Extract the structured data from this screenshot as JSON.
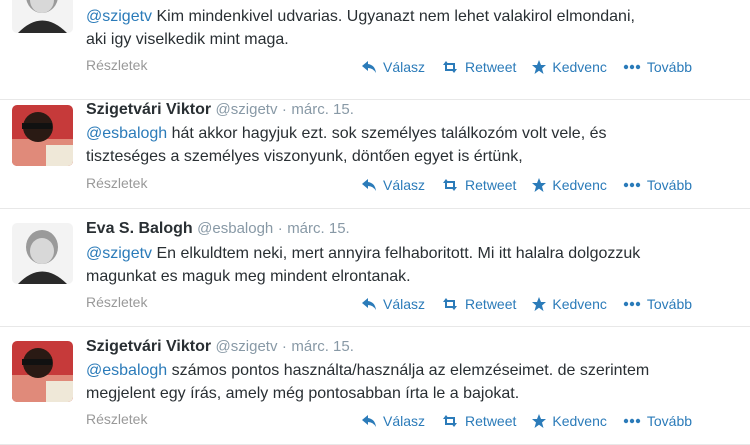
{
  "detailsLabel": "Részletek",
  "actions": {
    "reply": "Válasz",
    "retweet": "Retweet",
    "favorite": "Kedvenc",
    "more": "Tovább"
  },
  "colors": {
    "link": "#2b7bb9",
    "meta": "#8899a6"
  },
  "tweets": [
    {
      "name": "",
      "handle": "",
      "dot": "",
      "time": "",
      "mention": "@szigetv",
      "line1": " Kim mindenkivel udvarias. Ugyanazt nem lehet valakirol elmondani,",
      "line2": "aki igy viselkedik mint maga."
    },
    {
      "name": "Szigetvári Viktor",
      "handle": "@szigetv",
      "dot": "·",
      "time": "márc. 15.",
      "mention": "@esbalogh",
      "line1": " hát akkor hagyjuk ezt. sok személyes találkozóm volt vele, és",
      "line2": "tiszteséges a személyes viszonyunk, döntően egyet is értünk,"
    },
    {
      "name": "Eva S. Balogh",
      "handle": "@esbalogh",
      "dot": "·",
      "time": "márc. 15.",
      "mention": "@szigetv",
      "line1": " En elkuldtem neki, mert annyira felhaboritott. Mi itt halalra dolgozzuk",
      "line2": "magunkat es maguk meg mindent elrontanak."
    },
    {
      "name": "Szigetvári Viktor",
      "handle": "@szigetv",
      "dot": "·",
      "time": "márc. 15.",
      "mention": "@esbalogh",
      "line1": " számos pontos használta/használja az elemzéseimet. de szerintem",
      "line2": "megjelent egy írás, amely még pontosabban írta le a bajokat."
    }
  ]
}
